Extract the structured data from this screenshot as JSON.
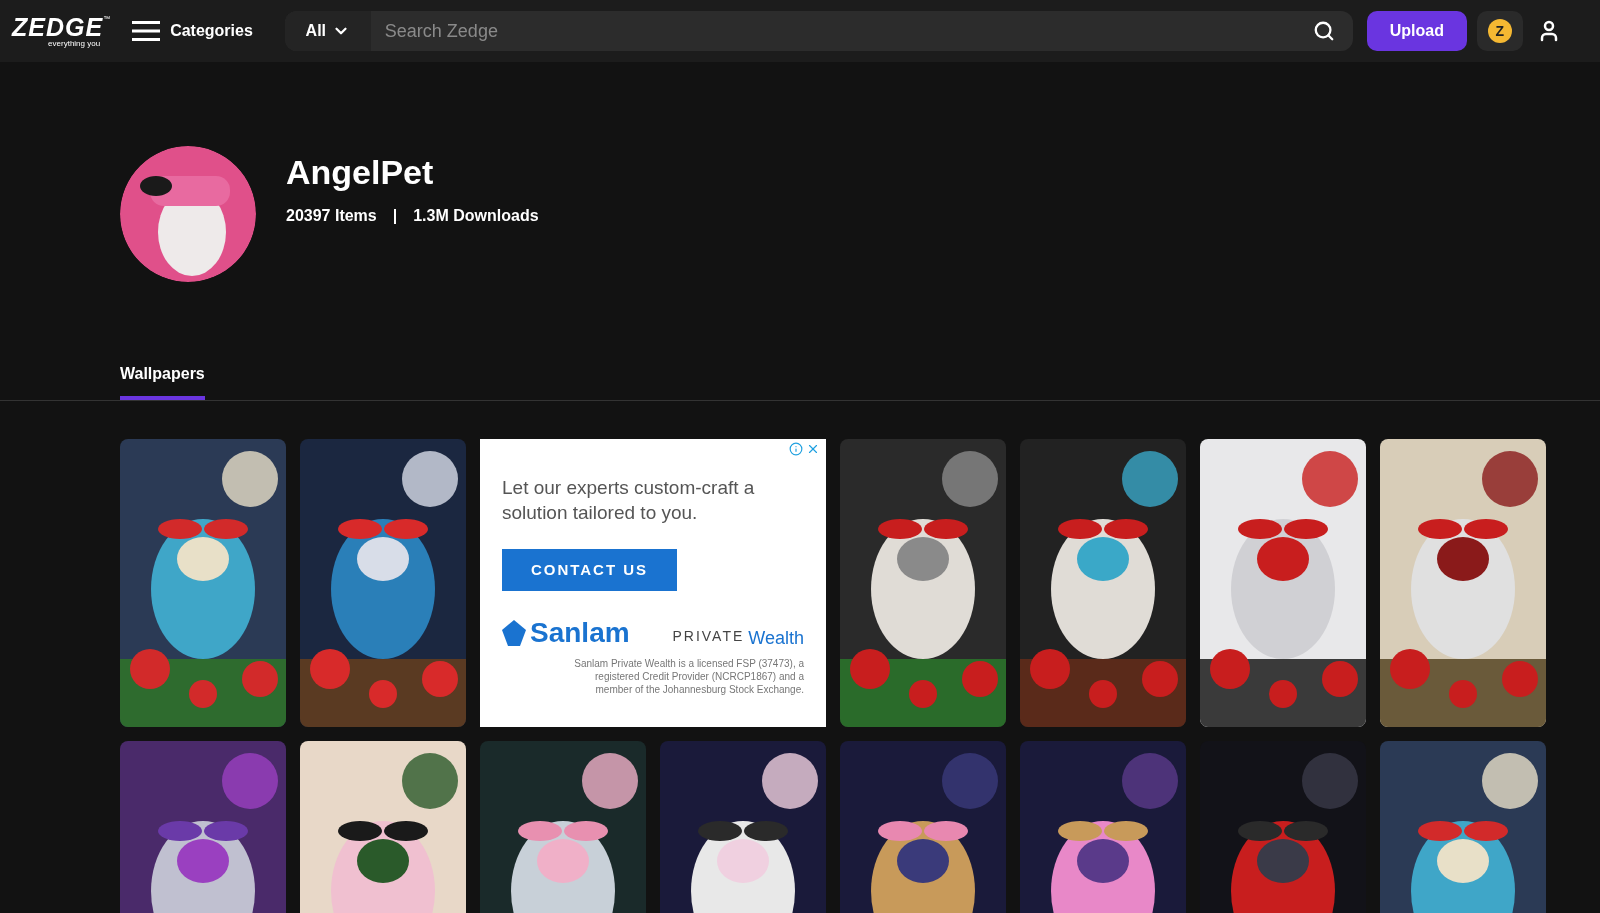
{
  "header": {
    "logo": {
      "wordmark": "ZEDGE",
      "trademark": "™",
      "tagline": "everything you"
    },
    "categories": "Categories",
    "search": {
      "scope": "All",
      "placeholder": "Search Zedge"
    },
    "upload": "Upload",
    "coin": "Z"
  },
  "profile": {
    "name": "AngelPet",
    "items": "20397 Items",
    "separator": "|",
    "downloads": "1.3M Downloads"
  },
  "tabs": [
    {
      "label": "Wallpapers",
      "selected": true
    }
  ],
  "grid": [
    {
      "kind": "picture"
    },
    {
      "kind": "picture"
    },
    {
      "kind": "ad",
      "headline": "Let our experts custom-craft a solution tailored to you.",
      "cta": "CONTACT US",
      "brand": "Sanlam",
      "private": "PRIVATE",
      "wealth": "Wealth",
      "disclaimer": "Sanlam Private Wealth is a licensed FSP (37473), a registered Credit Provider (NCRCP1867) and a member of the Johannesburg Stock Exchange."
    },
    {
      "kind": "picture"
    },
    {
      "kind": "picture"
    },
    {
      "kind": "picture"
    },
    {
      "kind": "picture"
    },
    {
      "kind": "picture"
    },
    {
      "kind": "picture"
    },
    {
      "kind": "picture"
    },
    {
      "kind": "picture"
    },
    {
      "kind": "picture"
    },
    {
      "kind": "picture"
    },
    {
      "kind": "picture"
    },
    {
      "kind": "picture"
    }
  ]
}
